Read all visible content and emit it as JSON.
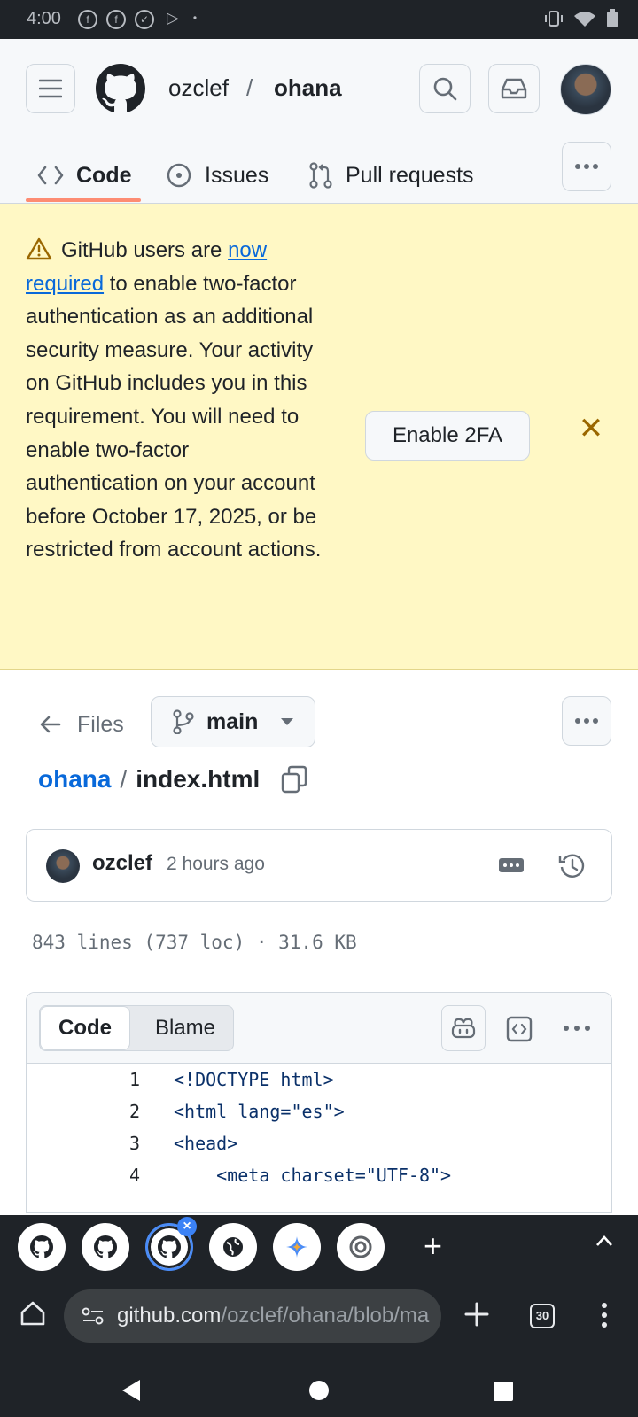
{
  "status_bar": {
    "time": "4:00"
  },
  "repo": {
    "owner": "ozclef",
    "slash": "/",
    "name": "ohana"
  },
  "tabs": [
    {
      "label": "Code"
    },
    {
      "label": "Issues"
    },
    {
      "label": "Pull requests"
    }
  ],
  "banner": {
    "text_before": "GitHub users are ",
    "link_text": "now required",
    "text_after": " to enable two-factor authentication as an additional security measure. Your activity on GitHub includes you in this requirement. You will need to enable two-factor authentication on your account before October 17, 2025, or be restricted from account actions.",
    "button_label": "Enable 2FA",
    "close_glyph": "✕"
  },
  "file_nav": {
    "files_label": "Files",
    "branch": "main",
    "path_repo": "ohana",
    "path_sep": "/",
    "file_name": "index.html"
  },
  "commit": {
    "author": "ozclef",
    "time": "2 hours ago"
  },
  "file_info": "843 lines (737 loc) · 31.6 KB",
  "code_view": {
    "tab_code": "Code",
    "tab_blame": "Blame",
    "lines": [
      {
        "num": "1",
        "text": "<!DOCTYPE html>"
      },
      {
        "num": "2",
        "text": "<html lang=\"es\">"
      },
      {
        "num": "3",
        "text": "<head>"
      },
      {
        "num": "4",
        "text": "    <meta charset=\"UTF-8\">"
      }
    ]
  },
  "browser": {
    "url_host": "github.com",
    "url_path": "/ozclef/ohana/blob/ma",
    "tab_count": "30",
    "accent": "#4a8cf7"
  },
  "colors": {
    "link": "#0969da",
    "banner_bg": "#fff8c5",
    "tab_underline": "#fd8c73",
    "warning": "#9a6700"
  }
}
